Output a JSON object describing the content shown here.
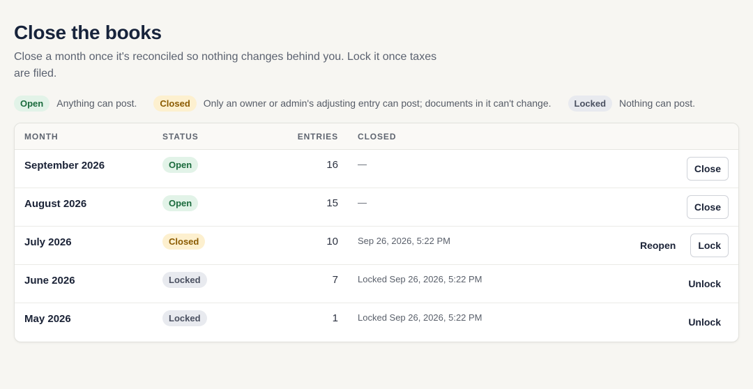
{
  "page": {
    "title": "Close the books",
    "subtitle": "Close a month once it's reconciled so nothing changes behind you. Lock it once taxes are filed."
  },
  "legend": [
    {
      "badge": "Open",
      "kind": "open",
      "desc": "Anything can post."
    },
    {
      "badge": "Closed",
      "kind": "closed",
      "desc": "Only an owner or admin's adjusting entry can post; documents in it can't change."
    },
    {
      "badge": "Locked",
      "kind": "locked",
      "desc": "Nothing can post."
    }
  ],
  "table": {
    "headers": {
      "month": "MONTH",
      "status": "STATUS",
      "entries": "ENTRIES",
      "closed": "CLOSED"
    },
    "rows": [
      {
        "month": "September 2026",
        "status": "Open",
        "kind": "open",
        "entries": "16",
        "closed": "—",
        "actions": [
          "Close"
        ]
      },
      {
        "month": "August 2026",
        "status": "Open",
        "kind": "open",
        "entries": "15",
        "closed": "—",
        "actions": [
          "Close"
        ]
      },
      {
        "month": "July 2026",
        "status": "Closed",
        "kind": "closed",
        "entries": "10",
        "closed": "Sep 26, 2026, 5:22 PM",
        "actions": [
          "Reopen",
          "Lock"
        ]
      },
      {
        "month": "June 2026",
        "status": "Locked",
        "kind": "locked",
        "entries": "7",
        "closed": "Locked Sep 26, 2026, 5:22 PM",
        "actions": [
          "Unlock"
        ]
      },
      {
        "month": "May 2026",
        "status": "Locked",
        "kind": "locked",
        "entries": "1",
        "closed": "Locked Sep 26, 2026, 5:22 PM",
        "actions": [
          "Unlock"
        ]
      }
    ]
  },
  "colors": {
    "background": "#f7f6f2",
    "title": "#17233b",
    "open_badge_bg": "#e2f3e8",
    "open_badge_text": "#1b6b3d",
    "closed_badge_bg": "#fdf0cf",
    "closed_badge_text": "#8a5a00",
    "locked_badge_bg": "#e8eaef",
    "locked_badge_text": "#4a5060"
  }
}
